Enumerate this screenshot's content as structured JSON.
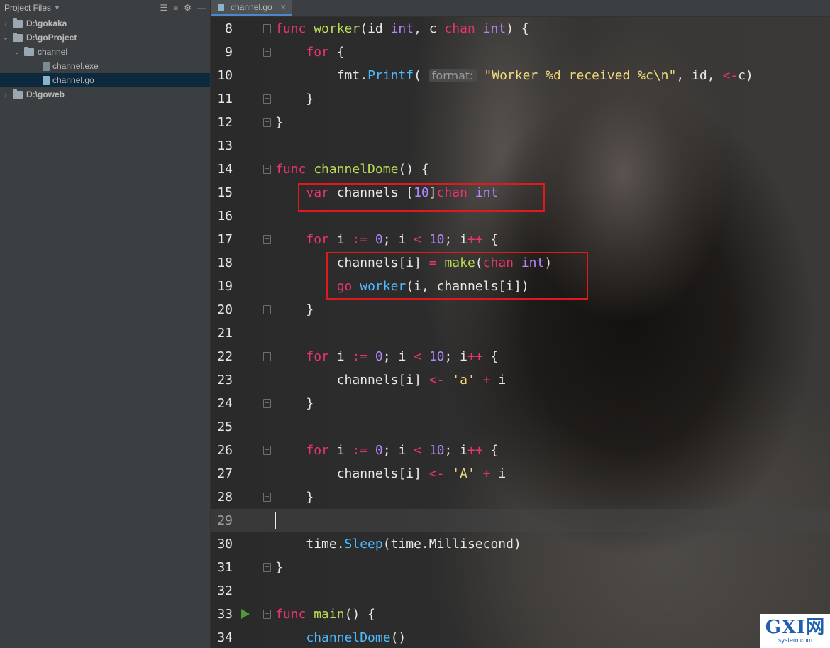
{
  "sidebar": {
    "title": "Project Files",
    "tree": [
      {
        "label": "D:\\gokaka",
        "level": 0,
        "kind": "folder",
        "expanded": false,
        "bold": true
      },
      {
        "label": "D:\\goProject",
        "level": 0,
        "kind": "folder",
        "expanded": true,
        "bold": true
      },
      {
        "label": "channel",
        "level": 1,
        "kind": "folder",
        "expanded": true,
        "bold": false
      },
      {
        "label": "channel.exe",
        "level": 2,
        "kind": "exe",
        "bold": false
      },
      {
        "label": "channel.go",
        "level": 2,
        "kind": "go",
        "bold": false,
        "selected": true
      },
      {
        "label": "D:\\goweb",
        "level": 0,
        "kind": "folder",
        "expanded": false,
        "bold": true
      }
    ]
  },
  "tab": {
    "label": "channel.go"
  },
  "editor": {
    "current_line": 29,
    "line_numbers": [
      "8",
      "9",
      "10",
      "11",
      "12",
      "13",
      "14",
      "15",
      "16",
      "17",
      "18",
      "19",
      "20",
      "21",
      "22",
      "23",
      "24",
      "25",
      "26",
      "27",
      "28",
      "29",
      "30",
      "31",
      "32",
      "33",
      "34"
    ],
    "inlay_hint": "format:",
    "code": {
      "l8": {
        "kw1": "func",
        "fn": "worker",
        "p1": "(id ",
        "t1": "int",
        ",": ", c ",
        "kw2": "chan",
        "t2": "int",
        "end": ") {"
      },
      "l9": {
        "kw": "for",
        "rest": " {"
      },
      "l10": {
        "a": "fmt.",
        "call": "Printf",
        "b": "(",
        "str": "\"Worker %d received %c\\n\"",
        "c": ", id, ",
        "op": "<-",
        "d": "c)"
      },
      "l11": "}",
      "l12": "}",
      "l14": {
        "kw": "func",
        "fn": "channelDome",
        "rest": "() {"
      },
      "l15": {
        "kw": "var",
        "a": " channels [",
        "num": "10",
        "b": "]",
        "kw2": "chan",
        "t": "int"
      },
      "l17": {
        "kw": "for",
        "a": " i ",
        "op": ":=",
        "b": " ",
        "n0": "0",
        "c": "; i ",
        "lt": "<",
        "d": " ",
        "n10": "10",
        "e": "; i",
        "pp": "++",
        "f": " {"
      },
      "l18": {
        "a": "channels[i] ",
        "eq": "=",
        "b": " ",
        "make": "make",
        "c": "(",
        "kw": "chan",
        "d": " ",
        "t": "int",
        "e": ")"
      },
      "l19": {
        "go": "go",
        "a": " ",
        "call": "worker",
        "b": "(i, channels[i])"
      },
      "l20": "}",
      "l22": {
        "kw": "for",
        "a": " i ",
        "op": ":=",
        "b": " ",
        "n0": "0",
        "c": "; i ",
        "lt": "<",
        "d": " ",
        "n10": "10",
        "e": "; i",
        "pp": "++",
        "f": " {"
      },
      "l23": {
        "a": "channels[i] ",
        "op": "<-",
        "b": " ",
        "str": "'a'",
        "c": " ",
        "plus": "+",
        "d": " i"
      },
      "l24": "}",
      "l26": {
        "kw": "for",
        "a": " i ",
        "op": ":=",
        "b": " ",
        "n0": "0",
        "c": "; i ",
        "lt": "<",
        "d": " ",
        "n10": "10",
        "e": "; i",
        "pp": "++",
        "f": " {"
      },
      "l27": {
        "a": "channels[i] ",
        "op": "<-",
        "b": " ",
        "str": "'A'",
        "c": " ",
        "plus": "+",
        "d": " i"
      },
      "l28": "}",
      "l30": {
        "a": "time.",
        "call": "Sleep",
        "b": "(time.Millisecond)"
      },
      "l31": "}",
      "l33": {
        "kw": "func",
        "fn": "main",
        "rest": "() {"
      },
      "l34": {
        "call": "channelDome",
        "rest": "()"
      }
    }
  },
  "watermark": {
    "logo": "GXI网",
    "sub": "system.com"
  },
  "colors": {
    "keyword": "#e8356a",
    "function": "#bada55",
    "type": "#b388ff",
    "string": "#f0d97a",
    "call": "#4fb9ff",
    "highlight_box": "#e0191f"
  }
}
